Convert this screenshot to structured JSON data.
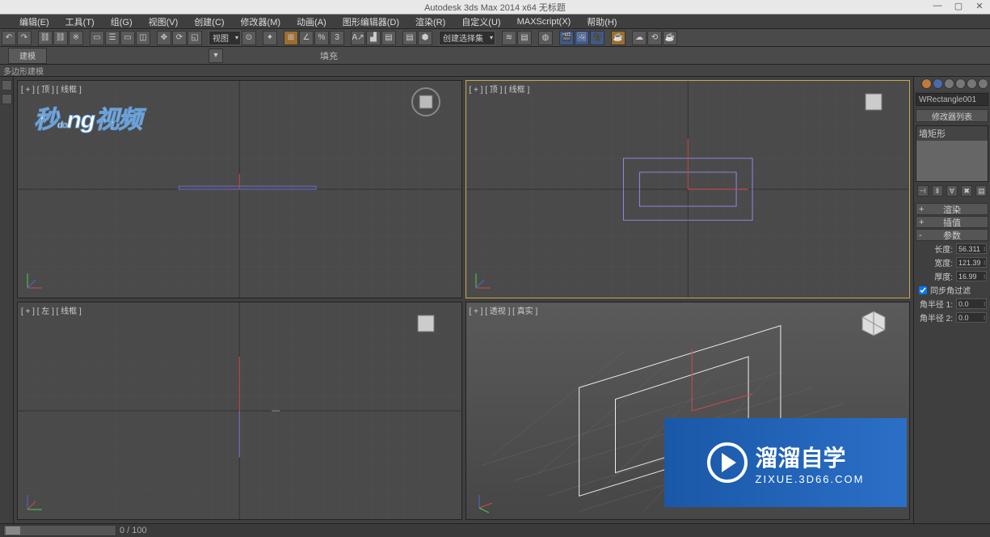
{
  "app": {
    "title": "Autodesk 3ds Max 2014 x64   无标题"
  },
  "menu": {
    "items": [
      "编辑(E)",
      "工具(T)",
      "组(G)",
      "视图(V)",
      "创建(C)",
      "修改器(M)",
      "动画(A)",
      "图形编辑器(D)",
      "渲染(R)",
      "自定义(U)",
      "MAXScript(X)",
      "帮助(H)"
    ]
  },
  "toolbar": {
    "dropdown1": "视图",
    "dropdown2": "创建选择集"
  },
  "ribbon": {
    "tab": "建模",
    "group_label": "填充"
  },
  "subbar": "多边形建模",
  "viewports": {
    "top_left": "[ + ] [ 顶 ] [ 线框 ]",
    "top_right": "[ + ] [ 顶 ] [ 线框 ]",
    "bot_left": "[ + ] [ 左 ] [ 线框 ]",
    "bot_right": "[ + ] [ 透视 ] [ 真实 ]"
  },
  "panel": {
    "obj_name": "WRectangle001",
    "modifier_header": "修改器列表",
    "modifier_item": "墙矩形",
    "rollouts": {
      "render": "渲染",
      "interp": "插值",
      "params": "参数"
    },
    "params": {
      "length_label": "长度:",
      "length": "56.311",
      "width_label": "宽度:",
      "width": "121.39",
      "thick_label": "厚度:",
      "thick": "16.99",
      "sync_label": "同步角过滤",
      "r1_label": "角半径 1:",
      "r1": "0.0",
      "r2_label": "角半径 2:",
      "r2": "0.0"
    }
  },
  "timeline": {
    "frame": "0 / 100"
  },
  "watermarks": {
    "wm1_text": "秒dong视频",
    "wm2_main": "溜溜自学",
    "wm2_sub": "ZIXUE.3D66.COM"
  }
}
